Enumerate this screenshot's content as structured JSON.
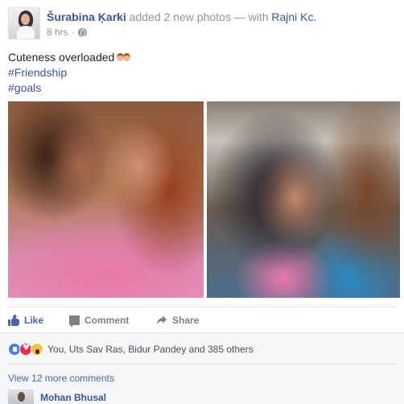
{
  "post": {
    "author": "Šurabina Ķarki",
    "action_text": " added 2 new photos — with ",
    "tagged": "Rajni Kc.",
    "timestamp": "8 hrs",
    "separator": "·",
    "privacy_icon": "globe-icon",
    "text_line1": "Cuteness overloaded",
    "emoji": "two-women-emoji",
    "hashtags": [
      "#Friendship",
      "#goals"
    ],
    "photo_count": 2
  },
  "actions": {
    "like_label": "Like",
    "comment_label": "Comment",
    "share_label": "Share"
  },
  "reactions": {
    "icons": [
      "like-reaction-icon",
      "love-reaction-icon",
      "wow-reaction-icon"
    ],
    "summary": "You, Uts Sav Ras, Bidur Pandey and 385 others"
  },
  "comments": {
    "view_more": "View 12 more comments",
    "first_commenter": "Mohan Bhusal"
  },
  "colors": {
    "link_blue": "#365899",
    "like_blue": "#4267b2",
    "muted_gray": "#90949c",
    "band_gray": "#f6f7f9"
  }
}
